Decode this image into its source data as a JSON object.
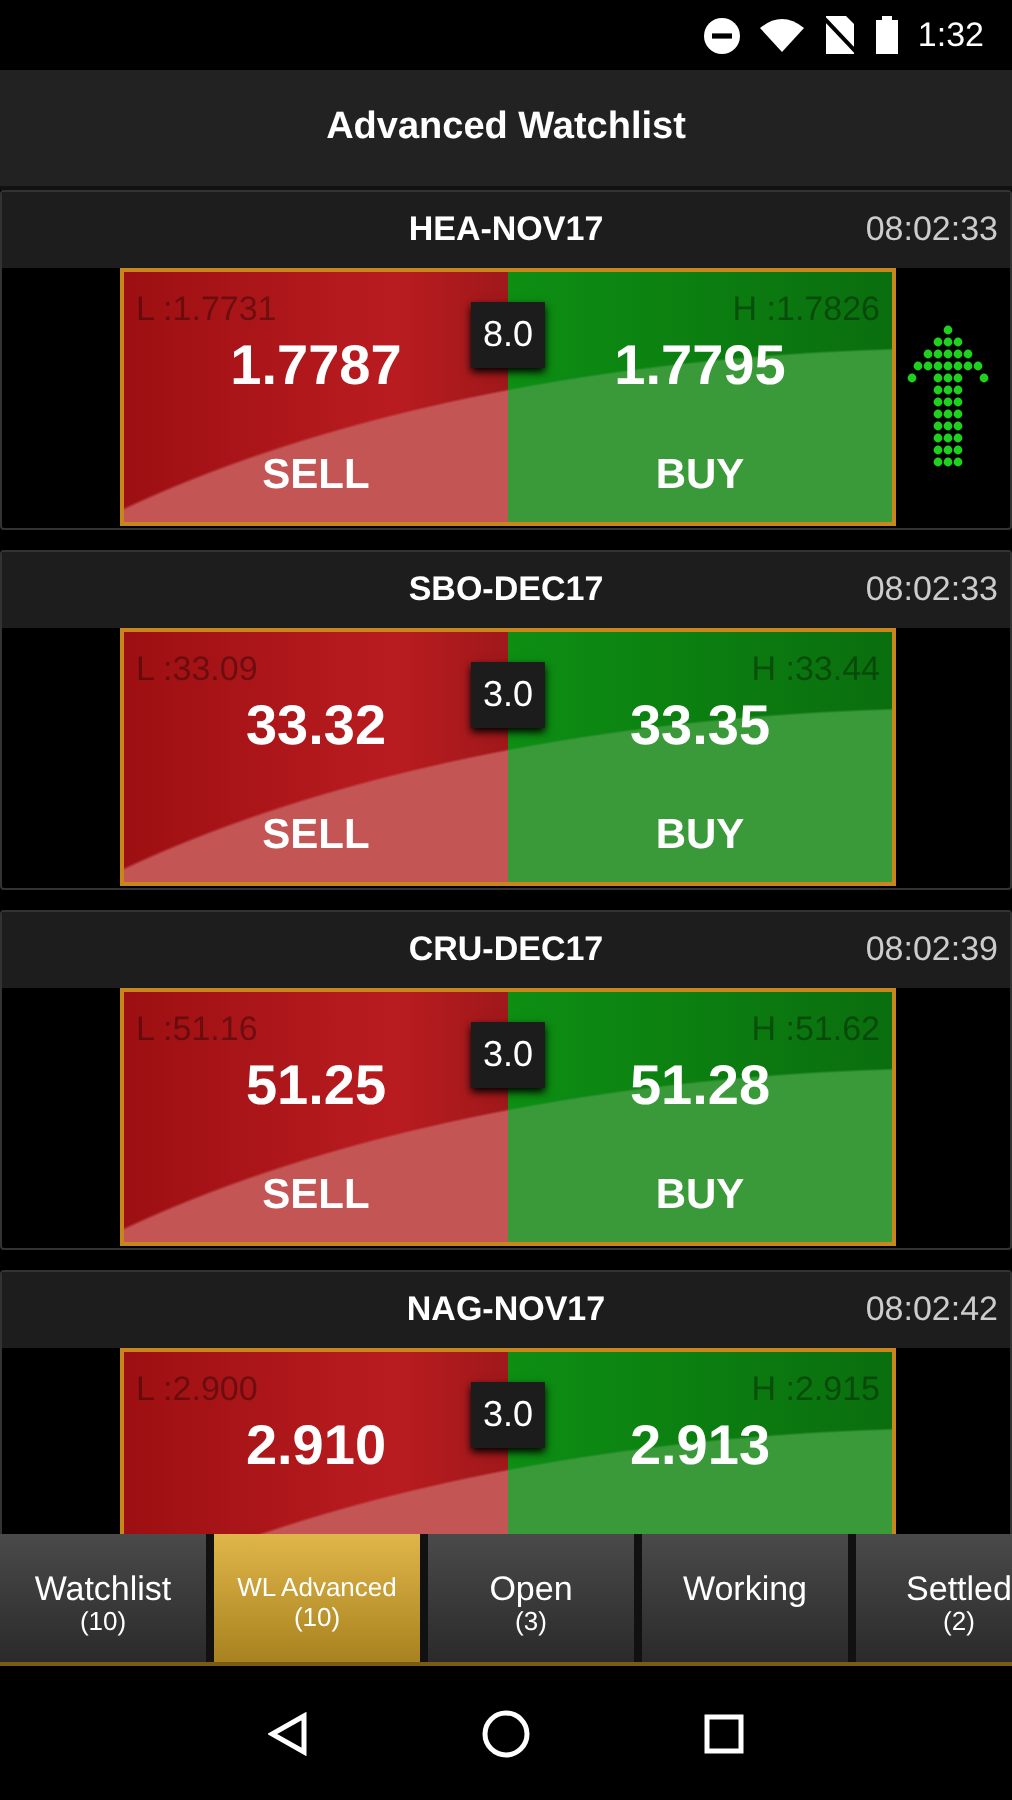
{
  "status_bar": {
    "time": "1:32"
  },
  "title": "Advanced Watchlist",
  "instruments": [
    {
      "symbol": "HEA-NOV17",
      "time": "08:02:33",
      "low": "L :1.7731",
      "bid": "1.7787",
      "spread": "8.0",
      "high": "H :1.7826",
      "ask": "1.7795",
      "sell": "SELL",
      "buy": "BUY",
      "trend_up": true
    },
    {
      "symbol": "SBO-DEC17",
      "time": "08:02:33",
      "low": "L :33.09",
      "bid": "33.32",
      "spread": "3.0",
      "high": "H :33.44",
      "ask": "33.35",
      "sell": "SELL",
      "buy": "BUY"
    },
    {
      "symbol": "CRU-DEC17",
      "time": "08:02:39",
      "low": "L :51.16",
      "bid": "51.25",
      "spread": "3.0",
      "high": "H :51.62",
      "ask": "51.28",
      "sell": "SELL",
      "buy": "BUY"
    },
    {
      "symbol": "NAG-NOV17",
      "time": "08:02:42",
      "low": "L :2.900",
      "bid": "2.910",
      "spread": "3.0",
      "high": "H :2.915",
      "ask": "2.913"
    }
  ],
  "tabs": [
    {
      "label": "Watchlist",
      "count": "(10)",
      "selected": false
    },
    {
      "label": "WL Advanced",
      "count": "(10)",
      "selected": true
    },
    {
      "label": "Open",
      "count": "(3)",
      "selected": false
    },
    {
      "label": "Working",
      "selected": false
    },
    {
      "label": "Settled",
      "count": "(2)",
      "selected": false
    }
  ]
}
